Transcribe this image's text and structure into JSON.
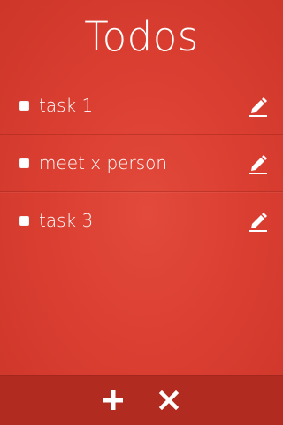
{
  "app": {
    "title": "Todos"
  },
  "todos": [
    {
      "label": "task 1",
      "checked": false,
      "edit_icon": "pencil-icon"
    },
    {
      "label": "meet x person",
      "checked": false,
      "edit_icon": "pencil-icon"
    },
    {
      "label": "task 3",
      "checked": false,
      "edit_icon": "pencil-icon"
    }
  ],
  "footer": {
    "add_icon": "plus-icon",
    "clear_icon": "close-icon"
  },
  "colors": {
    "background": "#db3f32",
    "footer": "#b12b21",
    "text": "#ffffff"
  }
}
